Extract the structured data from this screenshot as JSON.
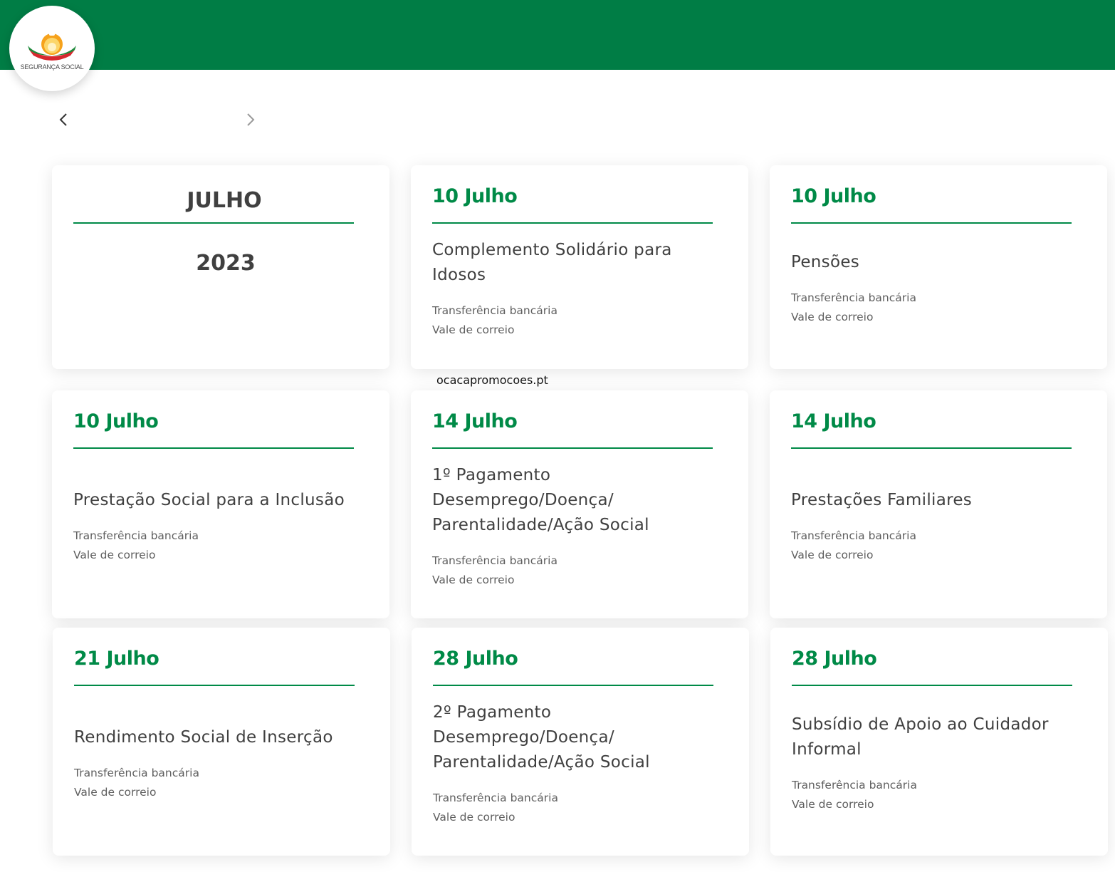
{
  "logo": {
    "text": "SEGURANÇA SOCIAL"
  },
  "colors": {
    "brand_green": "#007d45",
    "date_green": "#008a47",
    "text_dark": "#404040",
    "text_muted": "#5f5f5f"
  },
  "nav": {
    "prev_icon": "chevron-left-icon",
    "next_icon": "chevron-right-icon"
  },
  "month_card": {
    "month": "JULHO",
    "year": "2023"
  },
  "cards": [
    {
      "date": "10 Julho",
      "title_lines": [
        "Complemento Solidário para",
        "Idosos"
      ],
      "methods": [
        "Transferência bancária",
        "Vale de correio"
      ]
    },
    {
      "date": "10 Julho",
      "title_lines": [
        "Pensões"
      ],
      "methods": [
        "Transferência bancária",
        "Vale de correio"
      ]
    },
    {
      "date": "10 Julho",
      "title_lines": [
        "Prestação Social para a Inclusão"
      ],
      "methods": [
        "Transferência bancária",
        "Vale de correio"
      ]
    },
    {
      "date": "14 Julho",
      "title_lines": [
        "1º Pagamento",
        "Desemprego/Doença/",
        "Parentalidade/Ação Social"
      ],
      "methods": [
        "Transferência bancária",
        "Vale de correio"
      ]
    },
    {
      "date": "14 Julho",
      "title_lines": [
        "Prestações Familiares"
      ],
      "methods": [
        "Transferência bancária",
        "Vale de correio"
      ]
    },
    {
      "date": "21 Julho",
      "title_lines": [
        "Rendimento Social de Inserção"
      ],
      "methods": [
        "Transferência bancária",
        "Vale de correio"
      ]
    },
    {
      "date": "28 Julho",
      "title_lines": [
        "2º Pagamento",
        "Desemprego/Doença/",
        "Parentalidade/Ação Social"
      ],
      "methods": [
        "Transferência bancária",
        "Vale de correio"
      ]
    },
    {
      "date": "28 Julho",
      "title_lines": [
        "Subsídio de Apoio ao Cuidador",
        "Informal"
      ],
      "methods": [
        "Transferência bancária",
        "Vale de correio"
      ]
    }
  ],
  "watermark": "ocacapromocoes.pt"
}
